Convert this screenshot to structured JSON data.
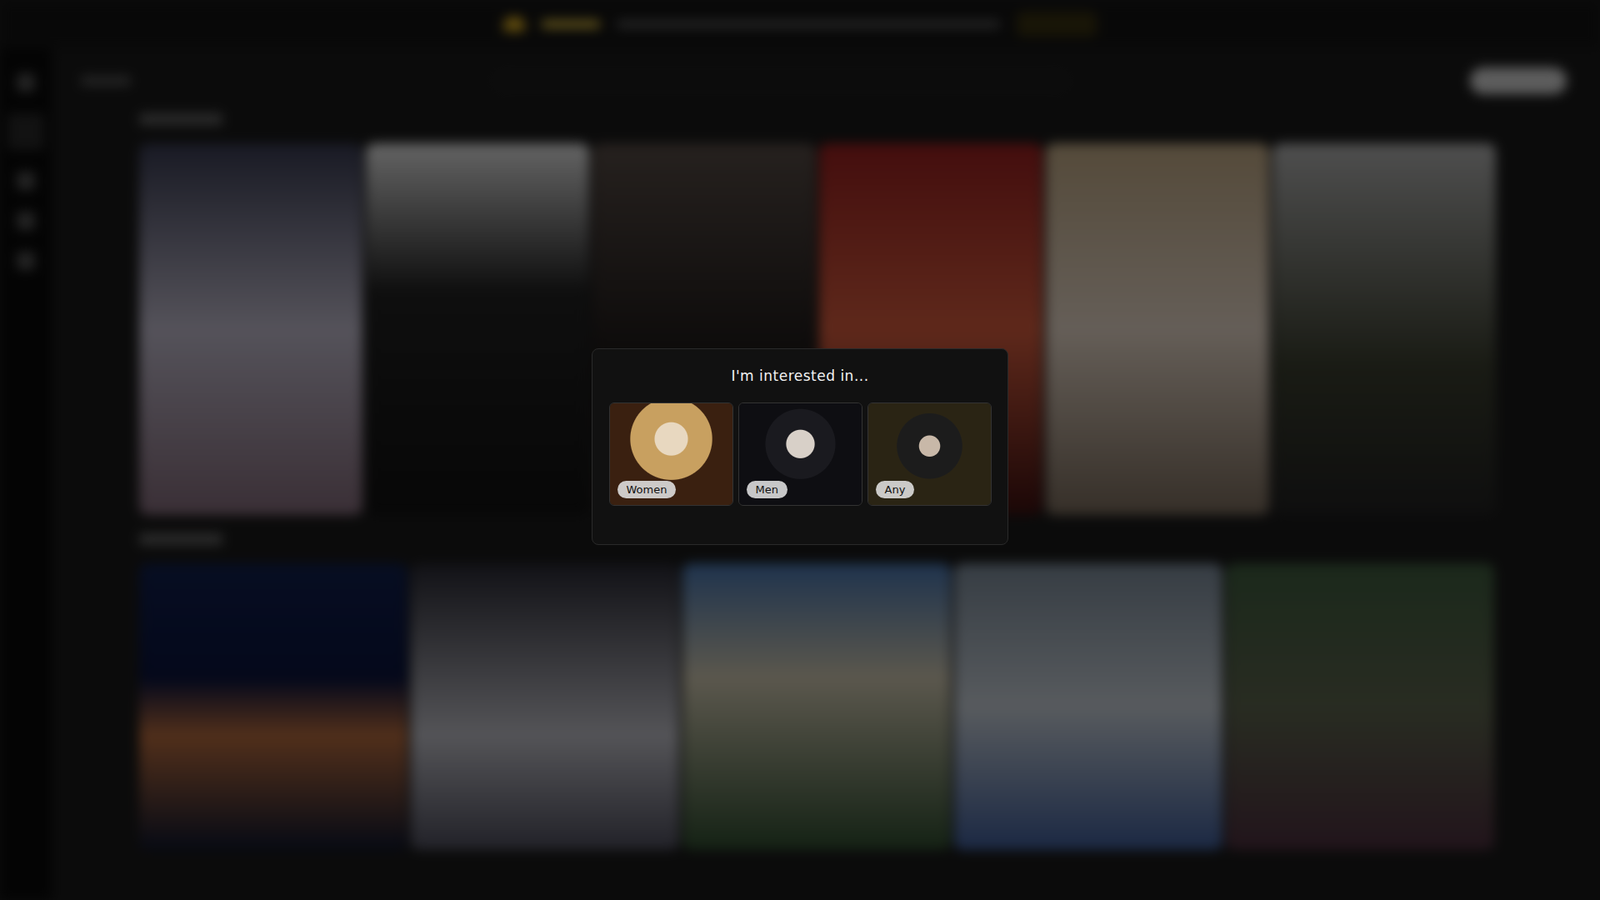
{
  "modal": {
    "title": "I'm interested in...",
    "options": [
      {
        "label": "Women",
        "selected": false
      },
      {
        "label": "Men",
        "selected": false
      },
      {
        "label": "Any",
        "selected": false
      }
    ]
  }
}
